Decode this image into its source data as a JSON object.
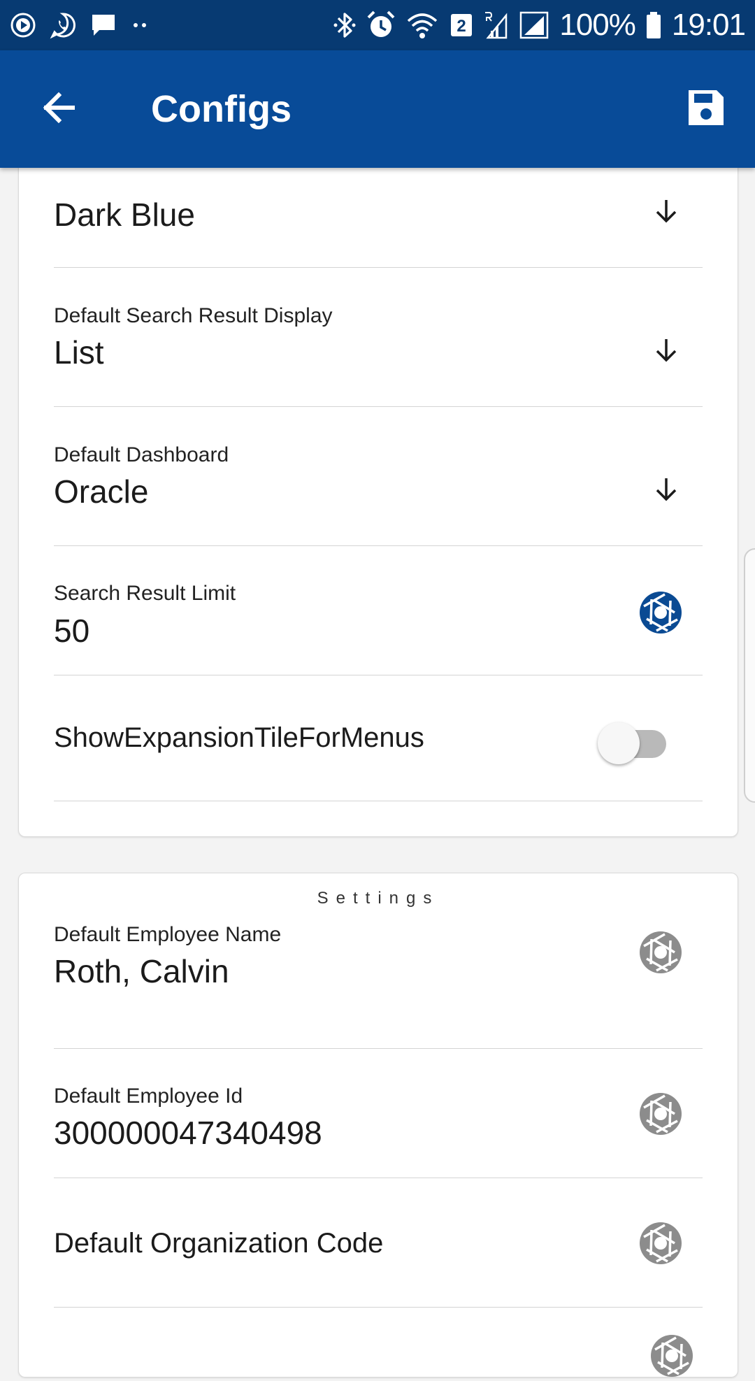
{
  "status_bar": {
    "sim_slot": "2",
    "battery": "100%",
    "time": "19:01"
  },
  "app_bar": {
    "title": "Configs"
  },
  "colors": {
    "status_bar": "#073a72",
    "app_bar": "#084b98",
    "accent_icon": "#0a4a93",
    "inactive_icon": "#8c8c8c"
  },
  "preferences_card": {
    "rows": [
      {
        "label": "",
        "value": "Dark Blue",
        "trailing_icon": "arrow-down-icon"
      },
      {
        "label": "Default Search Result Display",
        "value": "List",
        "trailing_icon": "arrow-down-icon"
      },
      {
        "label": "Default Dashboard",
        "value": "Oracle",
        "trailing_icon": "arrow-down-icon"
      },
      {
        "label": "Search Result Limit",
        "value": "50",
        "trailing_icon": "aperture-icon"
      },
      {
        "label": "ShowExpansionTileForMenus",
        "toggle_on": false
      }
    ]
  },
  "settings_card": {
    "title": "Settings",
    "rows": [
      {
        "label": "Default Employee Name",
        "value": "Roth, Calvin",
        "trailing_icon": "aperture-icon"
      },
      {
        "label": "Default Employee Id",
        "value": "300000047340498",
        "trailing_icon": "aperture-icon"
      },
      {
        "label": "Default Organization Code",
        "trailing_icon": "aperture-icon"
      }
    ]
  }
}
